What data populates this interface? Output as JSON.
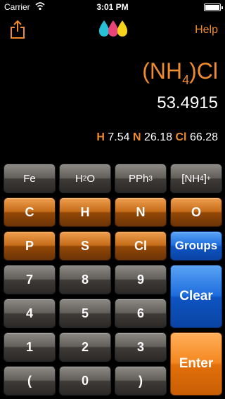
{
  "status_bar": {
    "carrier": "Carrier",
    "time": "3:01 PM"
  },
  "nav": {
    "help_label": "Help",
    "share_icon": "share-icon",
    "logo_icon": "drops-logo"
  },
  "display": {
    "formula_open": "(NH",
    "formula_sub": "4",
    "formula_close": ")Cl",
    "mass": "53.4915",
    "composition": [
      {
        "element": "H",
        "value": "7.54"
      },
      {
        "element": "N",
        "value": "26.18"
      },
      {
        "element": "Cl",
        "value": "66.28"
      }
    ]
  },
  "keys": {
    "fe": "Fe",
    "h2o_main": "H",
    "h2o_sub": "2",
    "h2o_end": "O",
    "pph3_main": "PPh",
    "pph3_sub": "3",
    "nh4_main": "[NH",
    "nh4_sub": "4",
    "nh4_end": "]",
    "nh4_sup": "+",
    "c": "C",
    "h": "H",
    "n": "N",
    "o": "O",
    "p": "P",
    "s": "S",
    "cl": "Cl",
    "groups": "Groups",
    "k7": "7",
    "k8": "8",
    "k9": "9",
    "clear": "Clear",
    "k4": "4",
    "k5": "5",
    "k6": "6",
    "k1": "1",
    "k2": "2",
    "k3": "3",
    "enter": "Enter",
    "paren_open": "(",
    "k0": "0",
    "paren_close": ")"
  },
  "colors": {
    "accent": "#ef8a2e",
    "blue": "#1e6ddd",
    "background": "#000000"
  }
}
